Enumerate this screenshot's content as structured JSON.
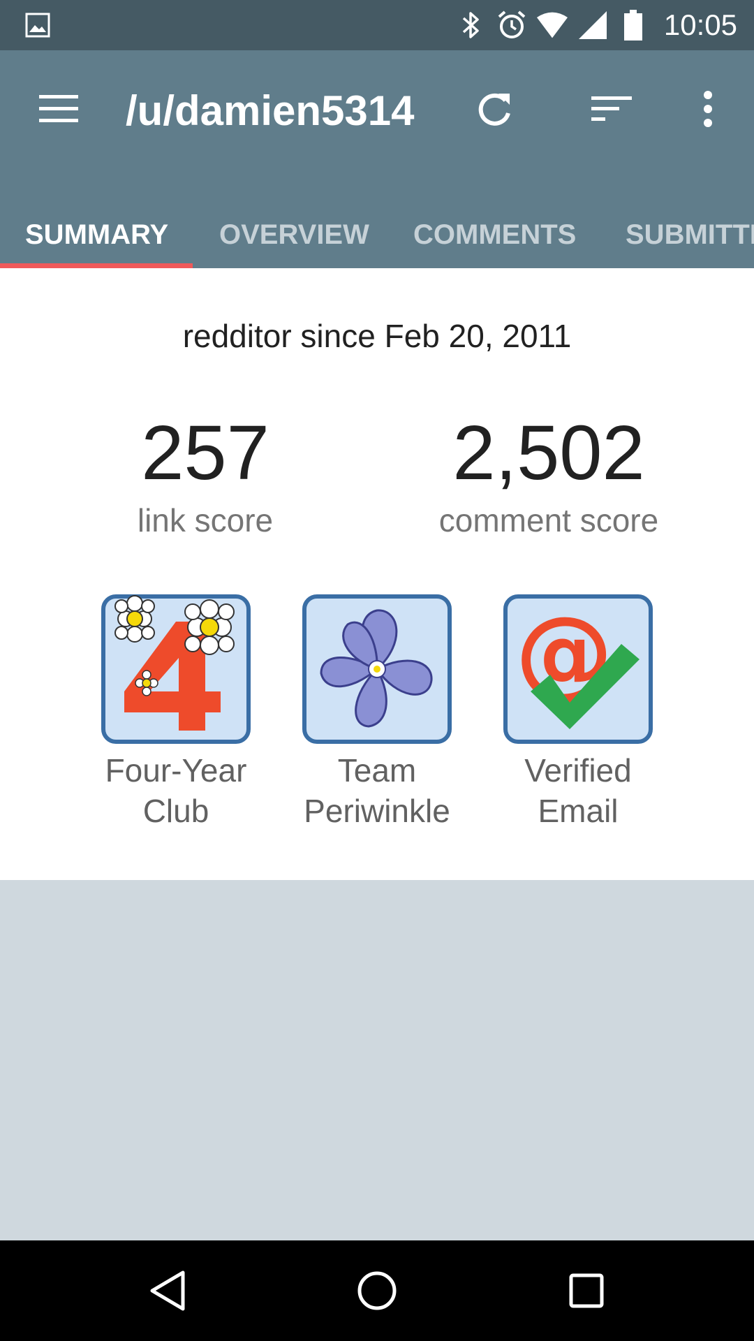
{
  "status_bar": {
    "time": "10:05",
    "icons": [
      "image-icon",
      "bluetooth-icon",
      "alarm-icon",
      "wifi-icon",
      "signal-icon",
      "battery-icon"
    ]
  },
  "toolbar": {
    "title": "/u/damien5314",
    "icons": [
      "menu-icon",
      "refresh-icon",
      "sort-icon",
      "more-vert-icon"
    ]
  },
  "tabs": [
    {
      "label": "SUMMARY",
      "active": true
    },
    {
      "label": "OVERVIEW",
      "active": false
    },
    {
      "label": "COMMENTS",
      "active": false
    },
    {
      "label": "SUBMITTED",
      "active": false
    }
  ],
  "summary": {
    "since": "redditor since Feb 20, 2011",
    "link_score": "257",
    "link_score_label": "link score",
    "comment_score": "2,502",
    "comment_score_label": "comment score"
  },
  "trophies": [
    {
      "line1": "Four-Year",
      "line2": "Club",
      "icon": "four-year-club-icon"
    },
    {
      "line1": "Team",
      "line2": "Periwinkle",
      "icon": "periwinkle-flower-icon"
    },
    {
      "line1": "Verified",
      "line2": "Email",
      "icon": "verified-email-icon"
    }
  ],
  "colors": {
    "status_bar": "#455a64",
    "app_bar": "#607d8b",
    "tab_indicator": "#f0595a",
    "background": "#cfd8de"
  }
}
